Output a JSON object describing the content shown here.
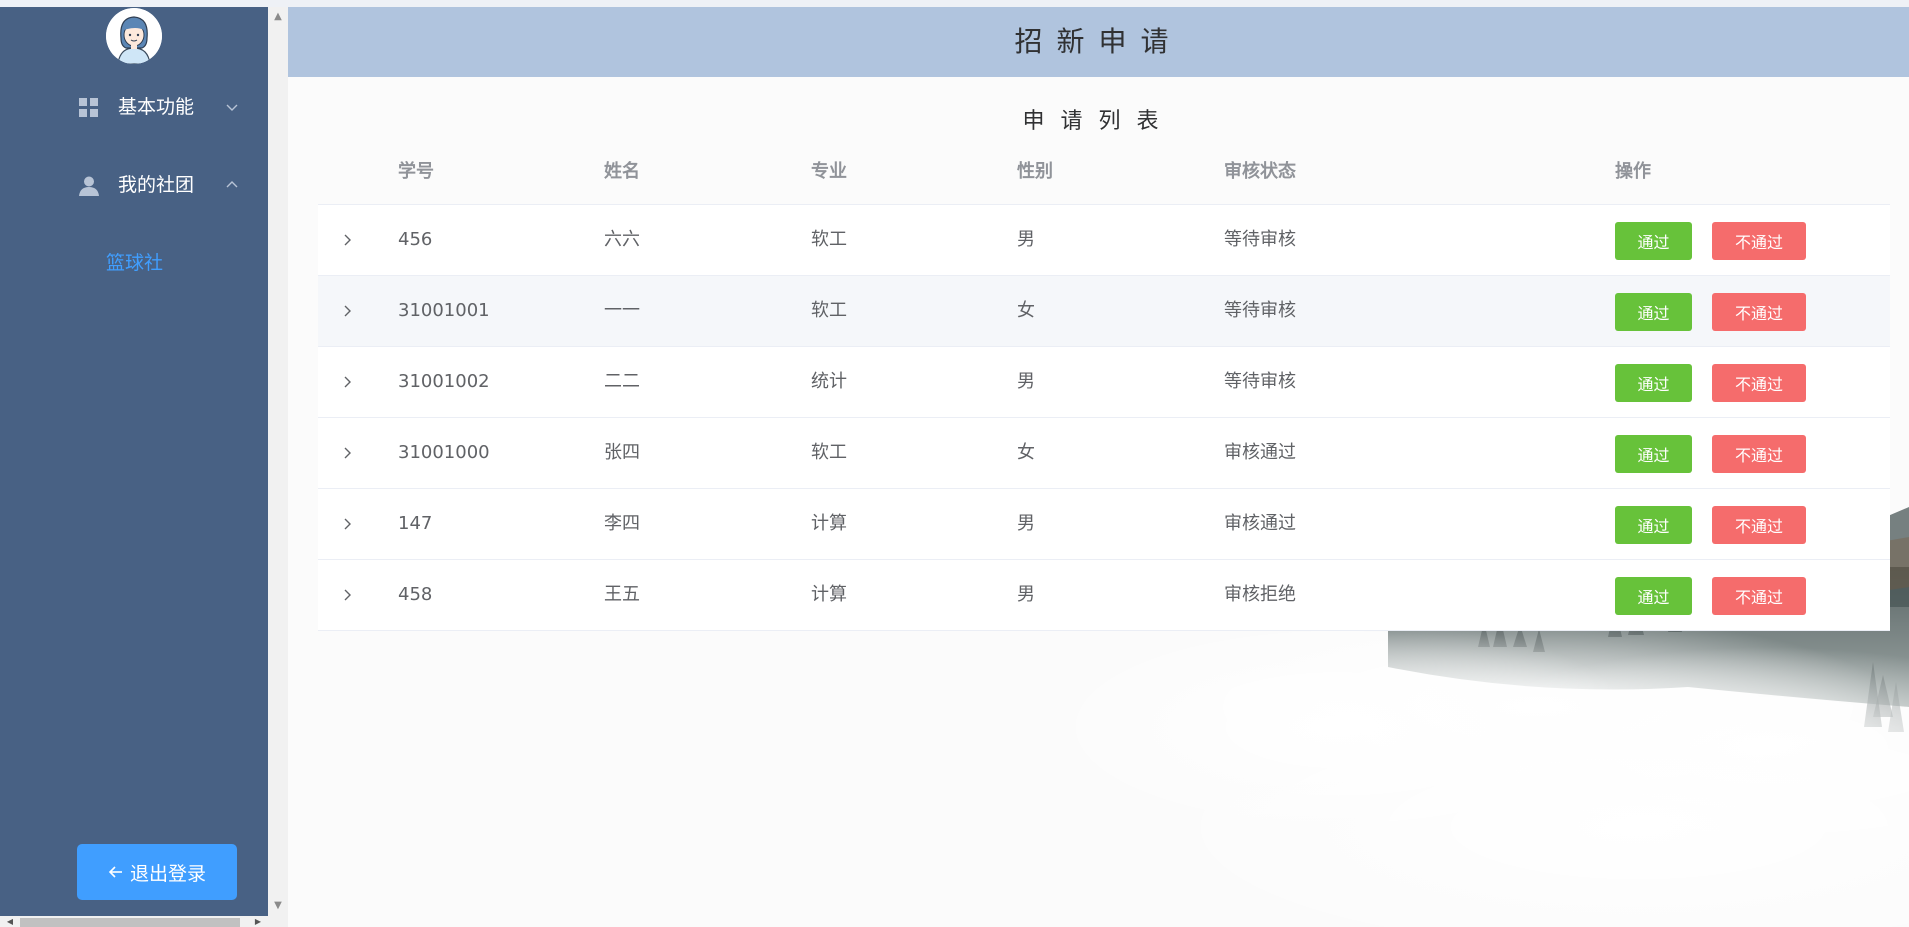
{
  "sidebar": {
    "menu": [
      {
        "label": "基本功能",
        "icon": "grid-icon",
        "expanded": false
      },
      {
        "label": "我的社团",
        "icon": "user-icon",
        "expanded": true
      }
    ],
    "submenu": [
      {
        "label": "篮球社"
      }
    ],
    "logout_label": "退出登录"
  },
  "header": {
    "title": "招新申请"
  },
  "list": {
    "title": "申请列表",
    "columns": [
      "学号",
      "姓名",
      "专业",
      "性别",
      "审核状态",
      "操作"
    ],
    "rows": [
      {
        "id": "456",
        "name": "六六",
        "major": "软工",
        "gender": "男",
        "status": "等待审核"
      },
      {
        "id": "31001001",
        "name": "一一",
        "major": "软工",
        "gender": "女",
        "status": "等待审核"
      },
      {
        "id": "31001002",
        "name": "二二",
        "major": "统计",
        "gender": "男",
        "status": "等待审核"
      },
      {
        "id": "31001000",
        "name": "张四",
        "major": "软工",
        "gender": "女",
        "status": "审核通过"
      },
      {
        "id": "147",
        "name": "李四",
        "major": "计算",
        "gender": "男",
        "status": "审核通过"
      },
      {
        "id": "458",
        "name": "王五",
        "major": "计算",
        "gender": "男",
        "status": "审核拒绝"
      }
    ],
    "pass_label": "通过",
    "reject_label": "不通过"
  },
  "colors": {
    "sidebar_bg": "#486184",
    "header_bg": "#b0c4de",
    "accent": "#409eff",
    "pass": "#67c23a",
    "reject": "#f56c6c"
  }
}
